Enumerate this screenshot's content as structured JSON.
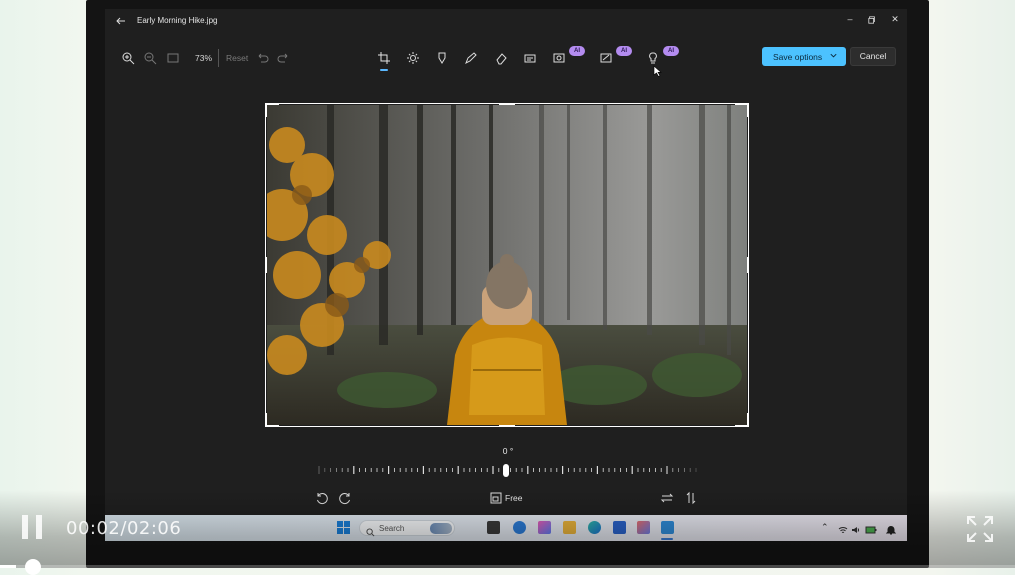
{
  "window": {
    "title": "Early Morning Hike.jpg"
  },
  "toolbar": {
    "zoom_value": "73%",
    "reset_label": "Reset",
    "ai_badge_label": "AI",
    "save_label": "Save options",
    "cancel_label": "Cancel",
    "active_tool": "crop",
    "tools": [
      "crop-icon",
      "brightness-icon",
      "markup-icon",
      "draw-icon",
      "erase-icon",
      "filter-icon",
      "background-ai-icon",
      "generative-erase-ai-icon",
      "relight-ai-icon"
    ]
  },
  "crop": {
    "angle_label": "0 °",
    "aspect_label": "Free",
    "rotation_degrees": 0
  },
  "taskbar": {
    "search_placeholder": "Search"
  },
  "video": {
    "time_label": "00:02/02:06",
    "progress_fraction": 0.016,
    "state": "playing"
  },
  "colors": {
    "accent": "#4cc2ff",
    "ai_badge": "#b48cf0",
    "editor_bg": "#1f1f1f"
  }
}
